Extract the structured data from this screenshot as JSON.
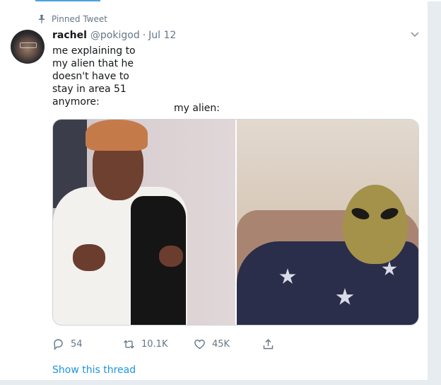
{
  "pinned": {
    "label": "Pinned Tweet",
    "icon": "pin-icon"
  },
  "user": {
    "name": "rachel",
    "handle": "@pokigod",
    "separator": "·",
    "date": "Jul 12",
    "avatar": "avatar"
  },
  "tweet": {
    "text": "me explaining to\nmy alien that he\ndoesn't have to\nstay in area 51\nanymore:",
    "text_right": "my alien:"
  },
  "media": {
    "photos": [
      {
        "description_icon": "photo-left"
      },
      {
        "description_icon": "photo-right"
      }
    ]
  },
  "actions": {
    "reply_count": "54",
    "retweet_count": "10.1K",
    "like_count": "45K",
    "share_icon": "share-icon"
  },
  "thread_link": "Show this thread",
  "colors": {
    "link": "#1b95e0",
    "muted": "#657786",
    "accent": "#4aa3df"
  }
}
